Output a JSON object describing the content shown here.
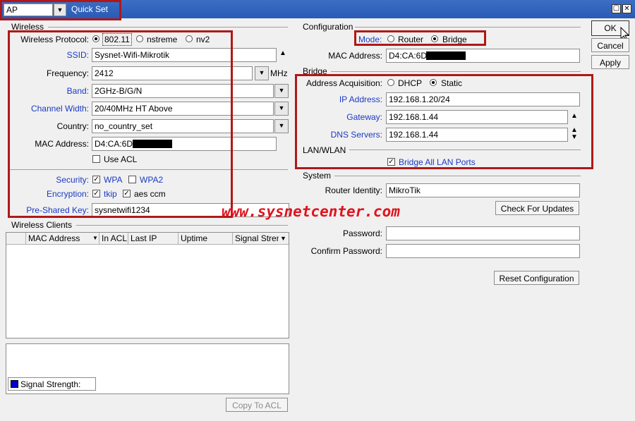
{
  "window": {
    "mode_value": "AP",
    "title": "Quick Set",
    "maximize_glyph": "▢",
    "close_glyph": "✕"
  },
  "buttons": {
    "ok": "OK",
    "cancel": "Cancel",
    "apply": "Apply",
    "check_updates": "Check For Updates",
    "reset": "Reset Configuration",
    "copy_to_acl": "Copy To ACL"
  },
  "wireless": {
    "section": "Wireless",
    "protocol_label": "Wireless Protocol:",
    "protocol_options": [
      "802.11",
      "nstreme",
      "nv2"
    ],
    "ssid_label": "SSID:",
    "ssid": "Sysnet-Wifi-Mikrotik",
    "frequency_label": "Frequency:",
    "frequency": "2412",
    "frequency_unit": "MHz",
    "band_label": "Band:",
    "band": "2GHz-B/G/N",
    "channel_width_label": "Channel Width:",
    "channel_width": "20/40MHz HT Above",
    "country_label": "Country:",
    "country": "no_country_set",
    "mac_label": "MAC Address:",
    "mac": "D4:CA:6D:",
    "use_acl": "Use ACL",
    "security_label": "Security:",
    "security_options": [
      "WPA",
      "WPA2"
    ],
    "encryption_label": "Encryption:",
    "encryption_options": [
      "tkip",
      "aes ccm"
    ],
    "psk_label": "Pre-Shared Key:",
    "psk": "sysnetwifi1234"
  },
  "clients": {
    "section": "Wireless Clients",
    "columns": [
      "MAC Address",
      "In ACL",
      "Last IP",
      "Uptime",
      "Signal Stren"
    ],
    "legend": "Signal Strength:"
  },
  "configuration": {
    "section": "Configuration",
    "mode_label": "Mode:",
    "mode_options": [
      "Router",
      "Bridge"
    ],
    "mac_label": "MAC Address:",
    "mac": "D4:CA:6D:"
  },
  "bridge": {
    "section": "Bridge",
    "acq_label": "Address Acquisition:",
    "acq_options": [
      "DHCP",
      "Static"
    ],
    "ip_label": "IP Address:",
    "ip": "192.168.1.20/24",
    "gateway_label": "Gateway:",
    "gateway": "192.168.1.44",
    "dns_label": "DNS Servers:",
    "dns": "192.168.1.44"
  },
  "lan": {
    "section": "LAN/WLAN",
    "bridge_all": "Bridge All LAN Ports"
  },
  "system": {
    "section": "System",
    "identity_label": "Router Identity:",
    "identity": "MikroTik",
    "password_label": "Password:",
    "confirm_label": "Confirm Password:"
  },
  "watermark": "www.sysnetcenter.com",
  "colors": {
    "highlight_box": "#b01818",
    "title_bar": "#2a5bb5",
    "link_label": "#1a3ac4",
    "watermark": "#e0141e",
    "signal_legend": "#0000cc"
  }
}
